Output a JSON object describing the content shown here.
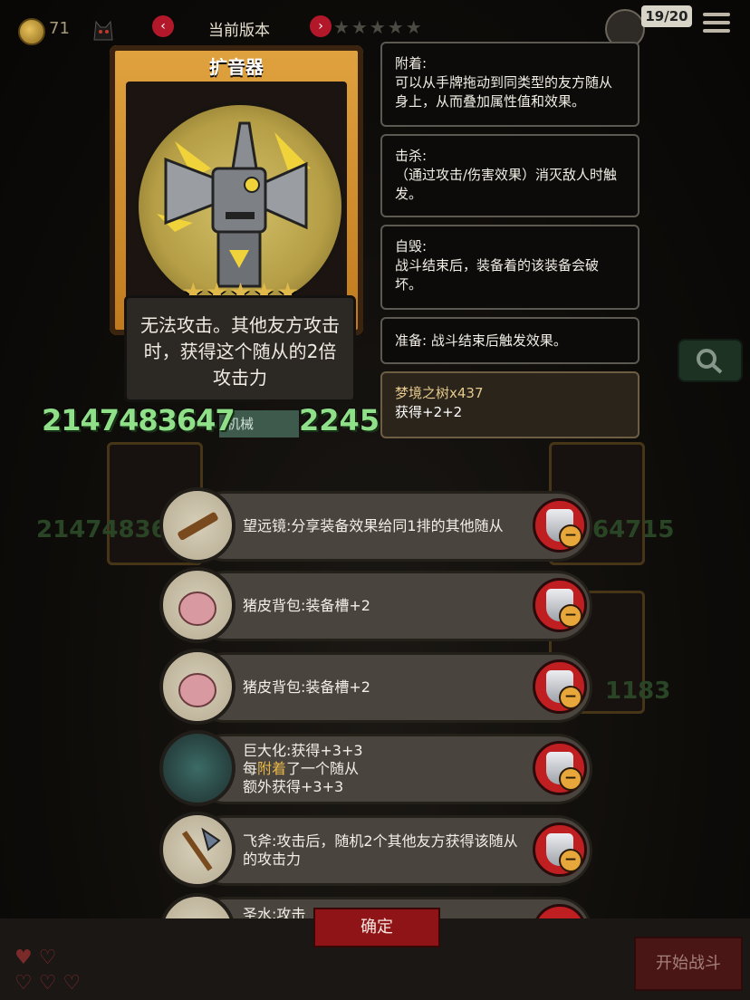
{
  "topbar": {
    "coins": "71",
    "version_label": "当前版本",
    "prev_arrow": "‹",
    "next_arrow": "›",
    "stars": "★★★★★",
    "roster_count": "19/20"
  },
  "card": {
    "name": "扩音器",
    "rating": "★★★★★",
    "description": "无法攻击。其他友方攻击时，获得这个随从的2倍攻击力",
    "attack": "2147483647",
    "health": "2245",
    "tribe": "机械"
  },
  "keywords": [
    {
      "title": "附着:",
      "text": "可以从手牌拖动到同类型的友方随从身上，从而叠加属性值和效果。"
    },
    {
      "title": "击杀:",
      "text": "（通过攻击/伤害效果）消灭敌人时触发。"
    },
    {
      "title": "自毁:",
      "text": "战斗结束后，装备着的该装备会破坏。"
    },
    {
      "title": "准备:",
      "text": "战斗结束后触发效果。"
    }
  ],
  "buff": {
    "title": "梦境之树x437",
    "text": "获得+2+2"
  },
  "equipment": [
    {
      "name": "望远镜",
      "desc": "望远镜:分享装备效果给同1排的其他随从"
    },
    {
      "name": "猪皮背包",
      "desc": "猪皮背包:装备槽+2"
    },
    {
      "name": "猪皮背包",
      "desc": "猪皮背包:装备槽+2"
    },
    {
      "name": "巨大化",
      "desc_a": "巨大化:获得+3+3",
      "desc_b": "每",
      "desc_hl": "附着",
      "desc_c": "了一个随从",
      "desc_d": "额外获得+3+3"
    },
    {
      "name": "飞斧",
      "desc": "飞斧:攻击后，随机2个其他友方获得该随从的攻击力"
    },
    {
      "name": "圣水",
      "desc": "圣水:攻击"
    }
  ],
  "background": {
    "num_left": "21474836",
    "num_right": "64715",
    "num_right2": "1183"
  },
  "buttons": {
    "confirm": "确定",
    "start_battle": "开始战斗",
    "remove_symbol": "−"
  },
  "colors": {
    "stat_green": "#8fe089",
    "card_gold": "#e0a23f",
    "remove_red": "#c01f22",
    "highlight_gold": "#e8b84a"
  },
  "icons": [
    "coin-icon",
    "cat-icon",
    "menu-icon",
    "search-icon",
    "shield-icon",
    "minus-icon",
    "heart-icon"
  ]
}
